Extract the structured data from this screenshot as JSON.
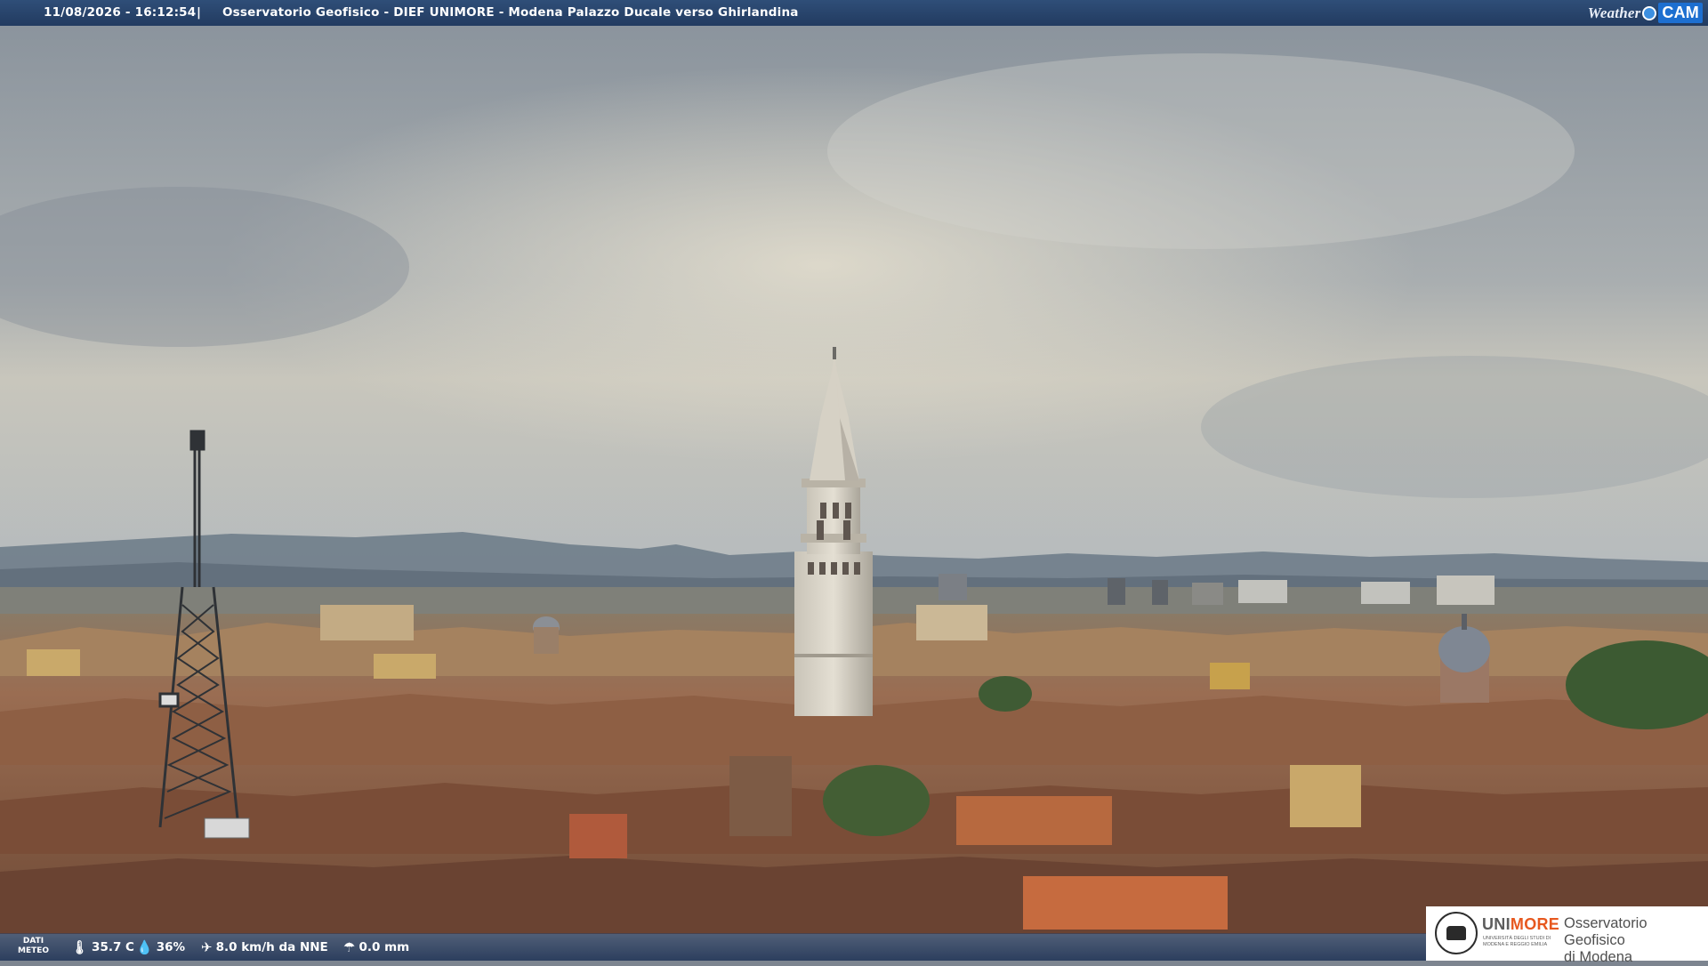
{
  "banner": {
    "timestamp": "11/08/2026 - 16:12:54",
    "separator": "|",
    "title": "Osservatorio Geofisico - DIEF UNIMORE - Modena Palazzo Ducale verso Ghirlandina",
    "logo_weather": "Weather",
    "logo_cam": "CAM"
  },
  "meteo": {
    "label_line1": "DATI",
    "label_line2": "METEO",
    "temperature": "35.7 C",
    "humidity": "36%",
    "wind": "8.0 km/h da NNE",
    "rain": "0.0 mm",
    "icons": [
      "thermometer-icon",
      "humidity-drop-icon",
      "wind-icon",
      "rain-gauge-icon"
    ]
  },
  "logo": {
    "unimore_prefix": "UNI",
    "unimore_suffix": "MORE",
    "university_sub": "UNIVERSITÀ DEGLI STUDI DI MODENA E REGGIO EMILIA",
    "observatory_line1": "Osservatorio Geofisico",
    "observatory_line2": "di Modena"
  },
  "colors": {
    "banner": "#2a4570",
    "cam_blue": "#1d6fd0",
    "unimore_orange": "#e7581f"
  }
}
